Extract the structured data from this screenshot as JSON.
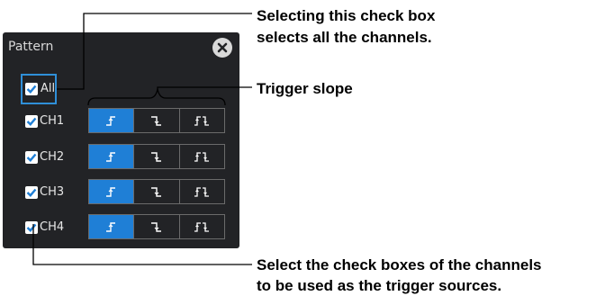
{
  "dialog": {
    "title": "Pattern"
  },
  "all_checkbox": {
    "label": "All",
    "checked": true
  },
  "channels": [
    {
      "label": "CH1",
      "checked": true,
      "slope_selected": "rising"
    },
    {
      "label": "CH2",
      "checked": true,
      "slope_selected": "rising"
    },
    {
      "label": "CH3",
      "checked": true,
      "slope_selected": "rising"
    },
    {
      "label": "CH4",
      "checked": true,
      "slope_selected": "rising"
    }
  ],
  "slope_options": [
    "rising",
    "falling",
    "both"
  ],
  "annotations": {
    "all_line1": "Selecting this check box",
    "all_line2": "selects all the channels.",
    "trigger_slope": "Trigger slope",
    "sources_line1": "Select the check boxes of the channels",
    "sources_line2": "to be used as the trigger sources."
  },
  "colors": {
    "panel_bg": "#222326",
    "accent_blue": "#1f7fd6",
    "focus_border": "#2f8fd8"
  }
}
